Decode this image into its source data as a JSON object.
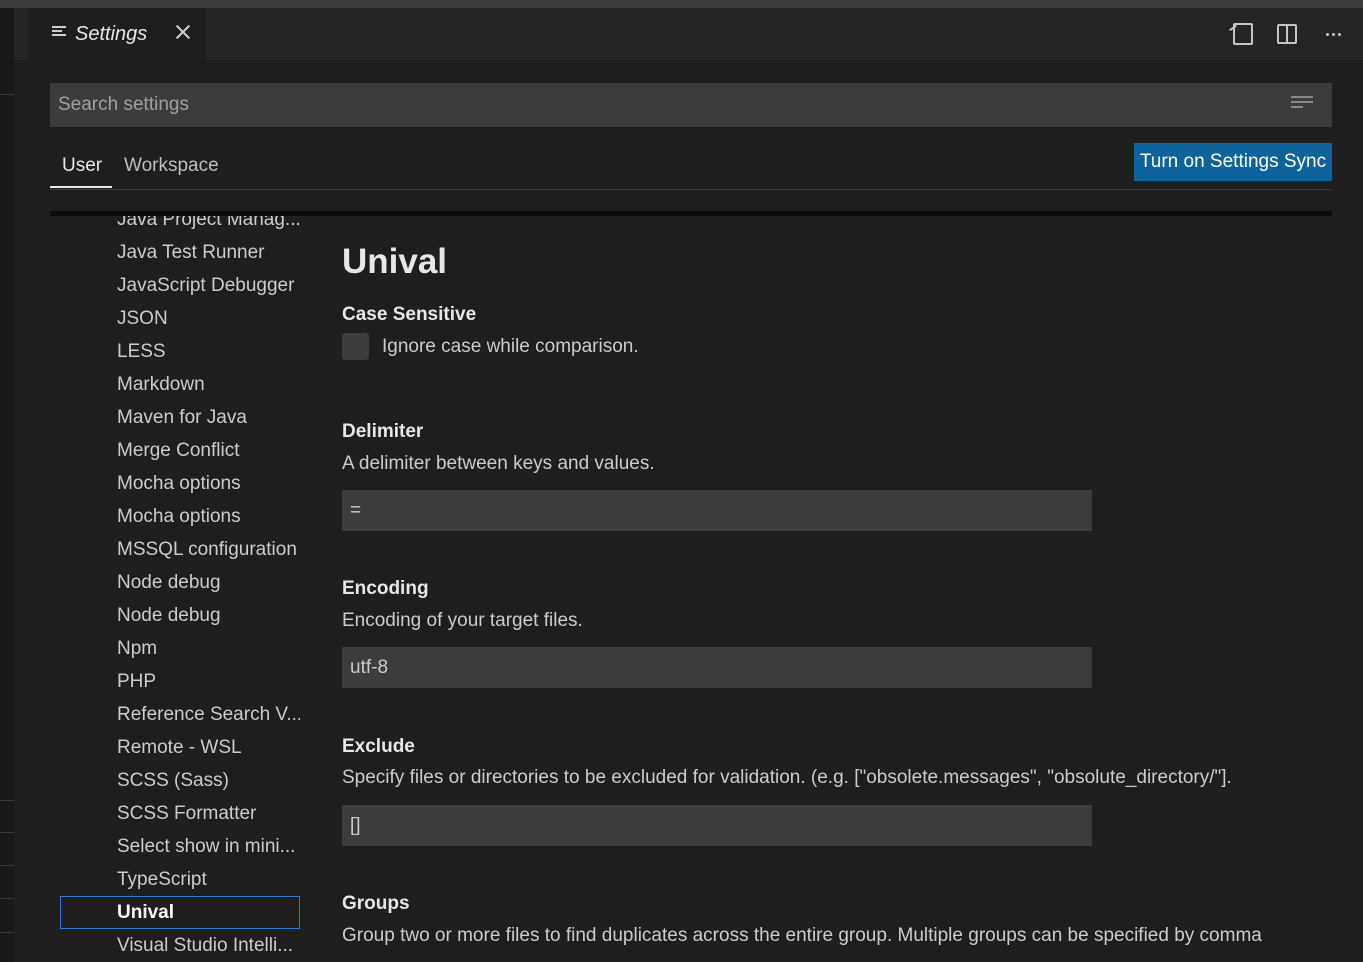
{
  "editor_tab": {
    "label": "Settings",
    "icon": "list-icon",
    "close_icon": "close-icon"
  },
  "actions": [
    "open-settings-json-icon",
    "split-editor-icon",
    "more-actions-icon"
  ],
  "search": {
    "placeholder": "Search settings",
    "value": ""
  },
  "scope_tabs": {
    "user": "User",
    "workspace": "Workspace",
    "active": "User"
  },
  "sync_button": "Turn on Settings Sync",
  "toc": [
    "Java Project Manag...",
    "Java Test Runner",
    "JavaScript Debugger",
    "JSON",
    "LESS",
    "Markdown",
    "Maven for Java",
    "Merge Conflict",
    "Mocha options",
    "Mocha options",
    "MSSQL configuration",
    "Node debug",
    "Node debug",
    "Npm",
    "PHP",
    "Reference Search V...",
    "Remote - WSL",
    "SCSS (Sass)",
    "SCSS Formatter",
    "Select show in mini...",
    "TypeScript",
    "Unival",
    "Visual Studio Intelli..."
  ],
  "toc_active": "Unival",
  "section": {
    "title": "Unival",
    "case_sensitive": {
      "title": "Case Sensitive",
      "label": "Ignore case while comparison.",
      "checked": false
    },
    "delimiter": {
      "title": "Delimiter",
      "desc": "A delimiter between keys and values.",
      "value": "="
    },
    "encoding": {
      "title": "Encoding",
      "desc": "Encoding of your target files.",
      "value": "utf-8"
    },
    "exclude": {
      "title": "Exclude",
      "desc": "Specify files or directories to be excluded for validation. (e.g. [\"obsolete.messages\", \"obsolute_directory/\"].",
      "value": "[]"
    },
    "groups": {
      "title": "Groups",
      "desc": "Group two or more files to find duplicates across the entire group. Multiple groups can be specified by comma"
    }
  },
  "colors": {
    "accent": "#0e639c",
    "focus_border": "#2f7ad1",
    "background": "#1e1e1e",
    "input_bg": "#3c3c3c"
  }
}
